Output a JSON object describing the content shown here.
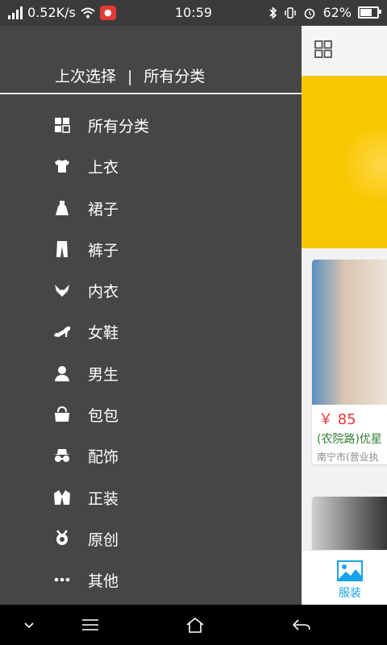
{
  "status_bar": {
    "network_speed": "0.52K/s",
    "time": "10:59",
    "battery": "62%",
    "battery_level": 0.62
  },
  "drawer": {
    "header": {
      "recent": "上次选择",
      "separator": "|",
      "all": "所有分类"
    },
    "items": [
      {
        "label": "所有分类",
        "icon": "grid-icon"
      },
      {
        "label": "上衣",
        "icon": "tshirt-icon"
      },
      {
        "label": "裙子",
        "icon": "dress-icon"
      },
      {
        "label": "裤子",
        "icon": "pants-icon"
      },
      {
        "label": "内衣",
        "icon": "lingerie-icon"
      },
      {
        "label": "女鞋",
        "icon": "heel-shoe-icon"
      },
      {
        "label": "男生",
        "icon": "man-icon"
      },
      {
        "label": "包包",
        "icon": "handbag-icon"
      },
      {
        "label": "配饰",
        "icon": "hat-glasses-icon"
      },
      {
        "label": "正装",
        "icon": "suit-icon"
      },
      {
        "label": "原创",
        "icon": "badge-icon"
      },
      {
        "label": "其他",
        "icon": "more-icon"
      }
    ]
  },
  "main": {
    "cards": [
      {
        "price": "￥ 85",
        "title": "(农院路)优星",
        "address": "南宁市(营业执"
      }
    ],
    "bottom_tab": {
      "label": "服装",
      "icon": "image-icon"
    }
  },
  "colors": {
    "drawer_bg": "#464646",
    "accent_blue": "#1aa3e8",
    "price_red": "#e53935",
    "banner_yellow": "#f7c700"
  }
}
